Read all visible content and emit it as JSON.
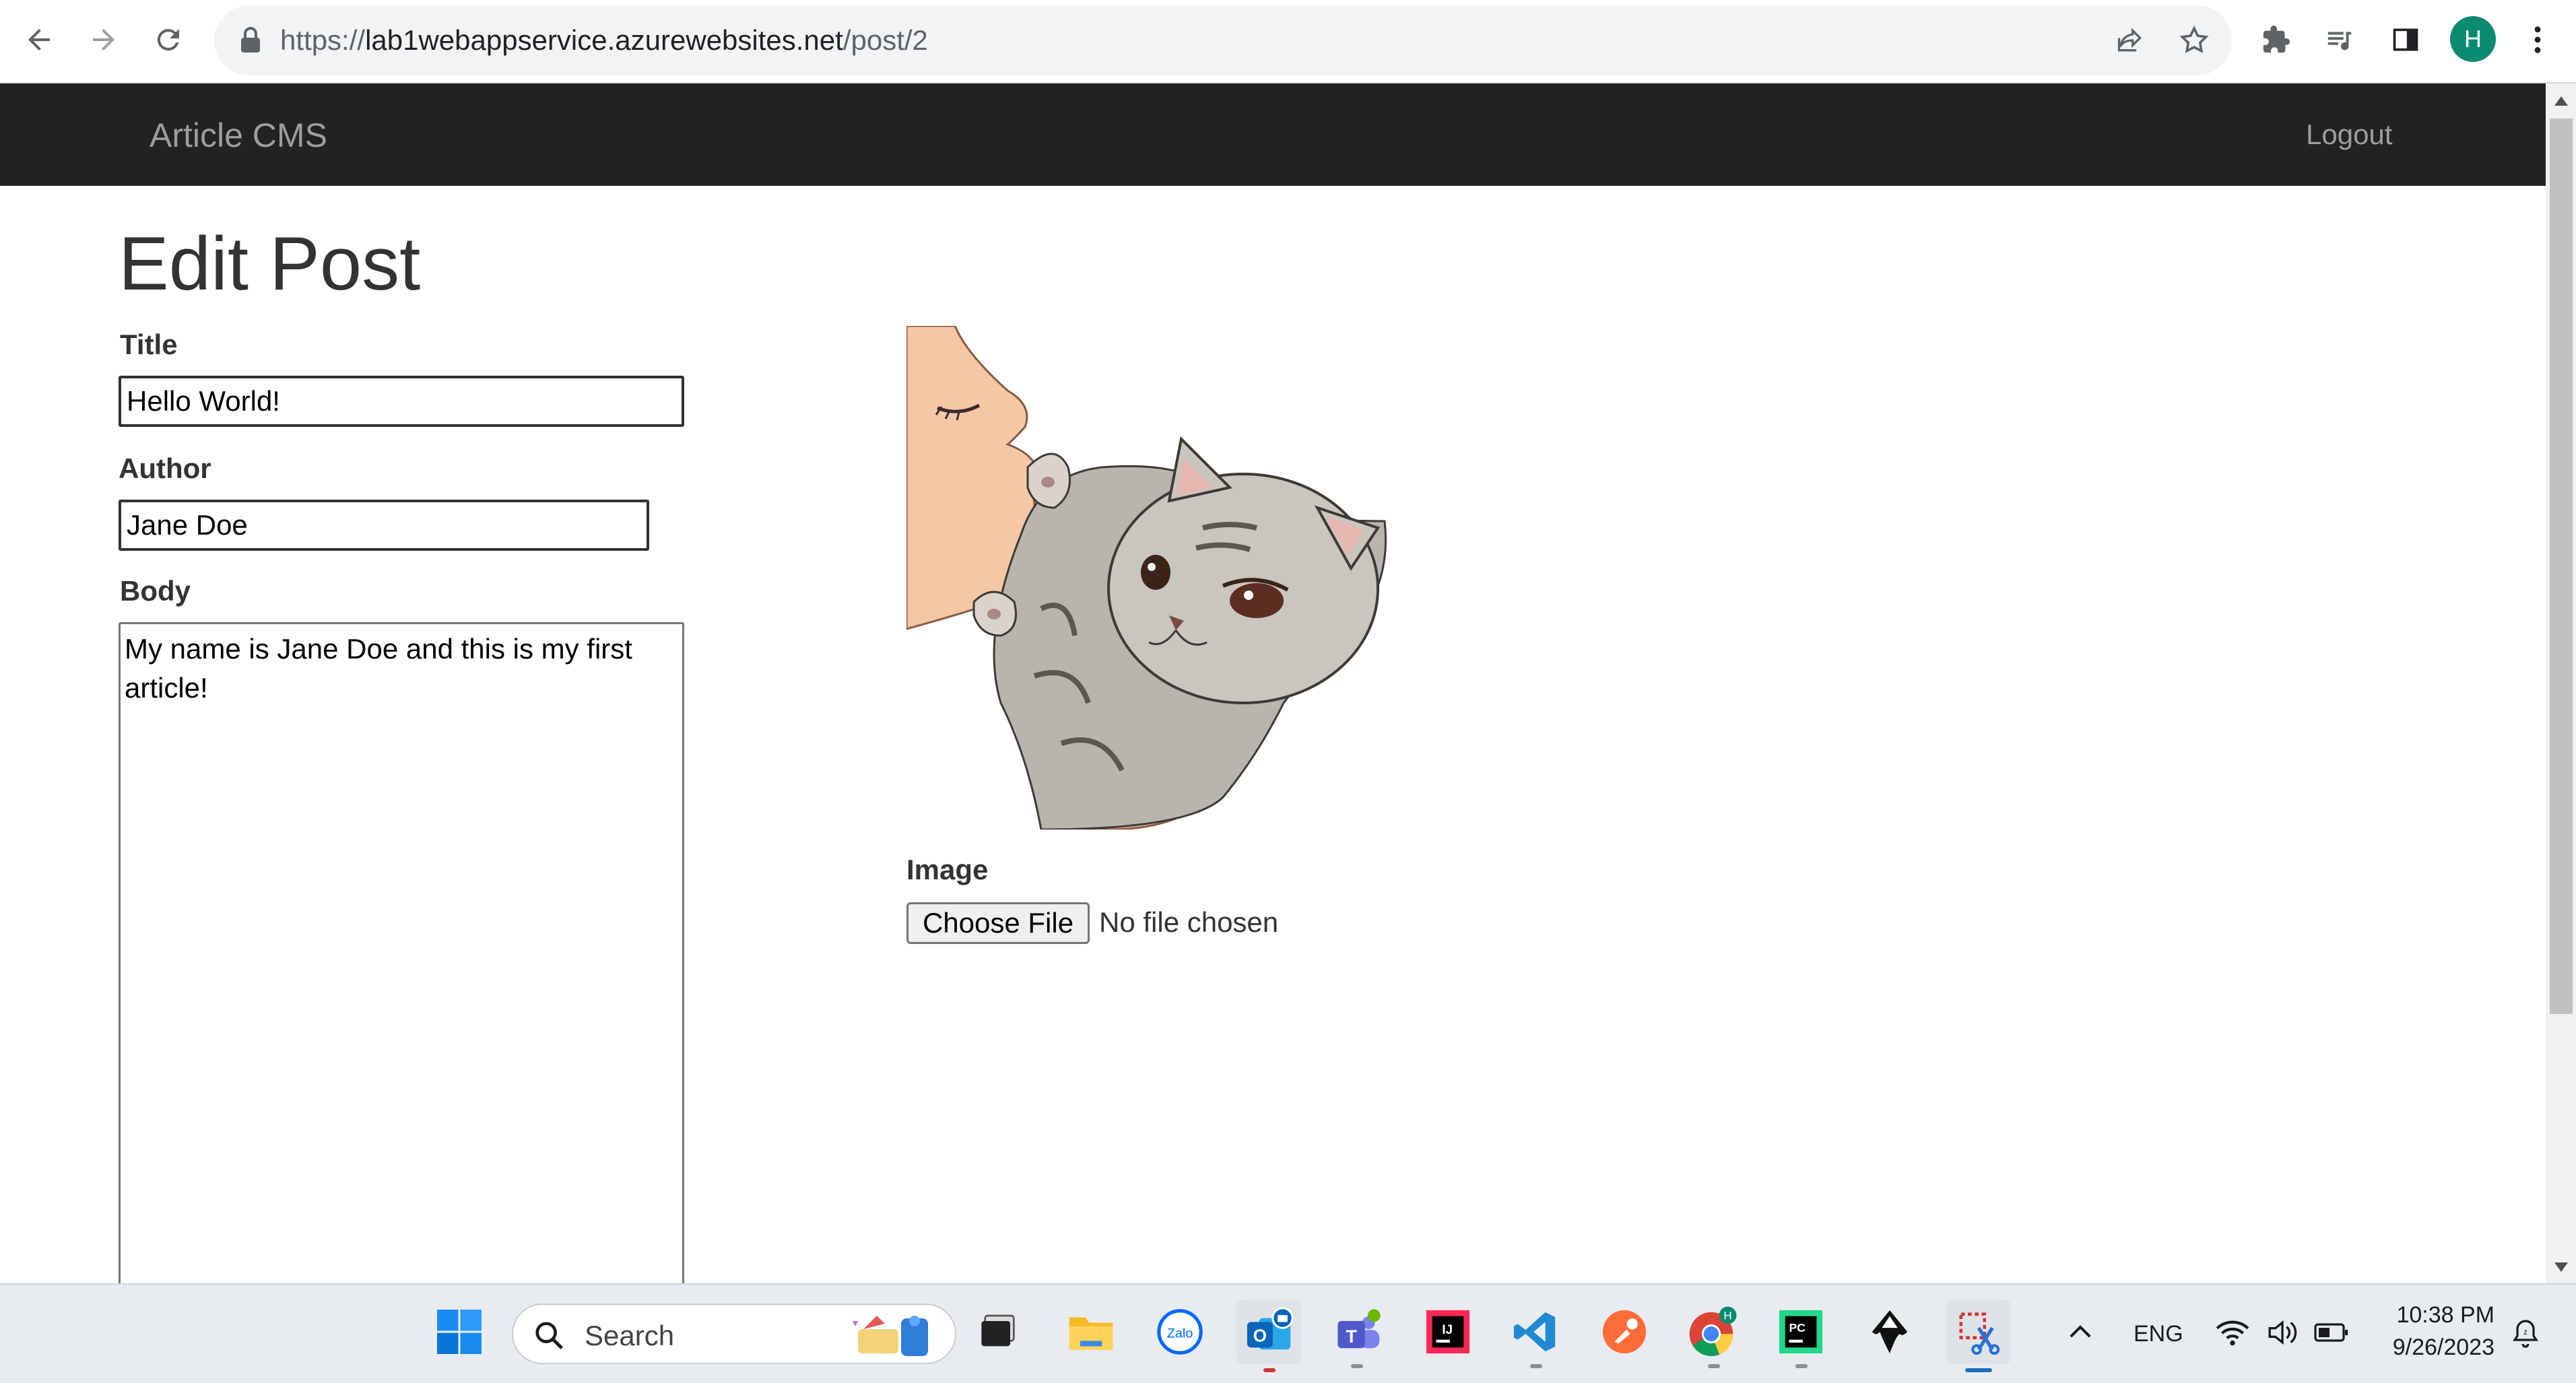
{
  "browser": {
    "url_scheme": "https://",
    "url_host": "lab1webappservice.azurewebsites.net",
    "url_path": "/post/2",
    "profile_initial": "H"
  },
  "site": {
    "brand": "Article CMS",
    "logout_label": "Logout"
  },
  "form": {
    "page_title": "Edit Post",
    "title_label": "Title",
    "title_value": "Hello World!",
    "author_label": "Author",
    "author_value": "Jane Doe",
    "body_label": "Body",
    "body_value": "My name is Jane Doe and this is my first article!",
    "image_label": "Image",
    "choose_file_label": "Choose File",
    "file_status": "No file chosen"
  },
  "taskbar": {
    "search_placeholder": "Search",
    "language": "ENG",
    "time": "10:38 PM",
    "date": "9/26/2023",
    "apps": [
      "start-icon",
      "search-icon",
      "task-view-icon",
      "file-explorer-icon",
      "zalo-icon",
      "outlook-icon",
      "teams-icon",
      "intellij-icon",
      "vscode-icon",
      "postman-icon",
      "chrome-icon",
      "pycharm-icon",
      "inkscape-icon",
      "snipping-tool-icon"
    ]
  }
}
